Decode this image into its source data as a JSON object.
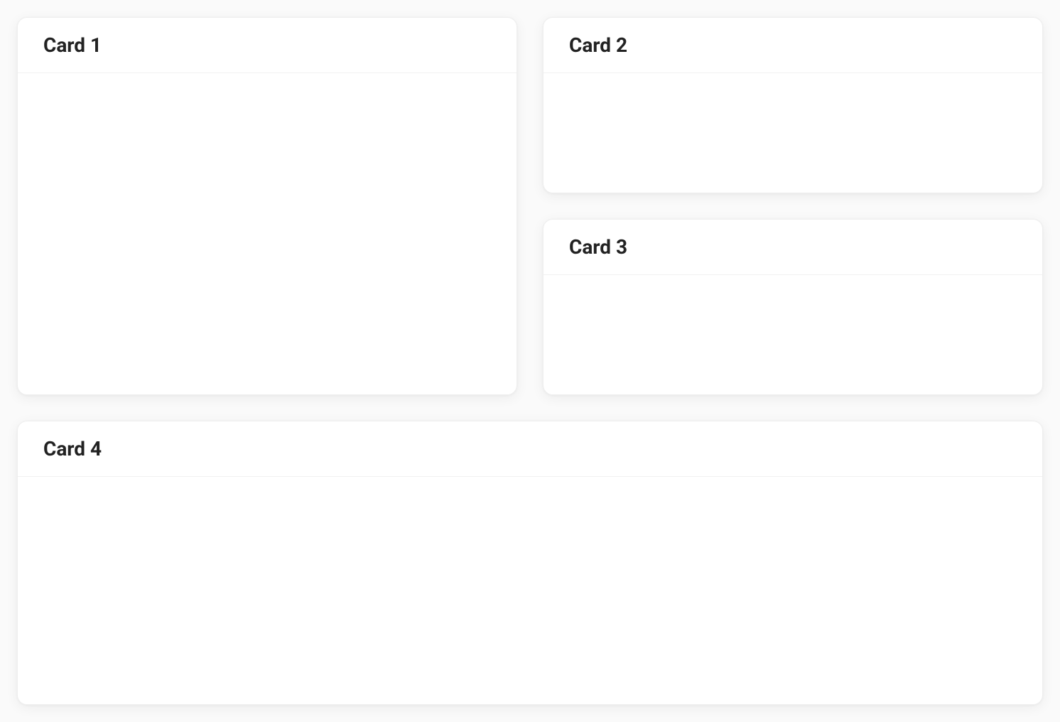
{
  "cards": [
    {
      "title": "Card 1"
    },
    {
      "title": "Card 2"
    },
    {
      "title": "Card 3"
    },
    {
      "title": "Card 4"
    }
  ]
}
